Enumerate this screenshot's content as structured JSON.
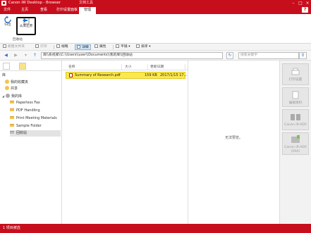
{
  "window": {
    "title": "Canon iW Desktop - Browser",
    "context_tab": "文档工具"
  },
  "tabs": [
    {
      "label": "文件"
    },
    {
      "label": "主页"
    },
    {
      "label": "查看"
    },
    {
      "label": "打印设置面板"
    },
    {
      "label": "管理"
    }
  ],
  "help_label": "?",
  "ribbon": {
    "back_label": "归位",
    "restore_label": "从库还原",
    "group_label": "回收站"
  },
  "toolbar": {
    "new_folder": "新建文件夹",
    "print": "打印",
    "thumbnail": "缩略",
    "details": "详细",
    "properties": "属性",
    "tile": "平铺",
    "sort": "排序"
  },
  "address": {
    "path": "库\\\\系统库\\\\C:\\\\Users\\\\user\\\\Documents\\\\我的库\\\\回收站",
    "search_placeholder": "搜索关键字"
  },
  "tree": {
    "root": "库",
    "favorites": "我的收藏夹",
    "shared": "共享",
    "my_library": "我的库",
    "folders": [
      {
        "label": "Paperless Fax"
      },
      {
        "label": "PDF Handling"
      },
      {
        "label": "Print Meeting Materials"
      },
      {
        "label": "Sample Folder"
      },
      {
        "label": "回收站"
      }
    ]
  },
  "list": {
    "headers": {
      "name": "名称",
      "size": "大小",
      "modified": "更新日期"
    },
    "rows": [
      {
        "name": "Summary of Research.pdf",
        "size": "159 KB",
        "modified": "2017/1/15 17..."
      }
    ]
  },
  "preview": {
    "message": "无法预览。"
  },
  "right_panel": [
    {
      "label": "打印设置",
      "icon": "print-settings-icon"
    },
    {
      "label": "编辑资料",
      "icon": "edit-document-icon"
    },
    {
      "label": "Canon iR-ADV",
      "icon": "printer-icon"
    },
    {
      "label": "Canon iR-ADV (FAX)",
      "icon": "fax-icon"
    }
  ],
  "status": {
    "text": "1 项目被选"
  },
  "colors": {
    "brand_red": "#c70e1d",
    "selection": "#fbe84e",
    "folder": "#f2c34f"
  }
}
